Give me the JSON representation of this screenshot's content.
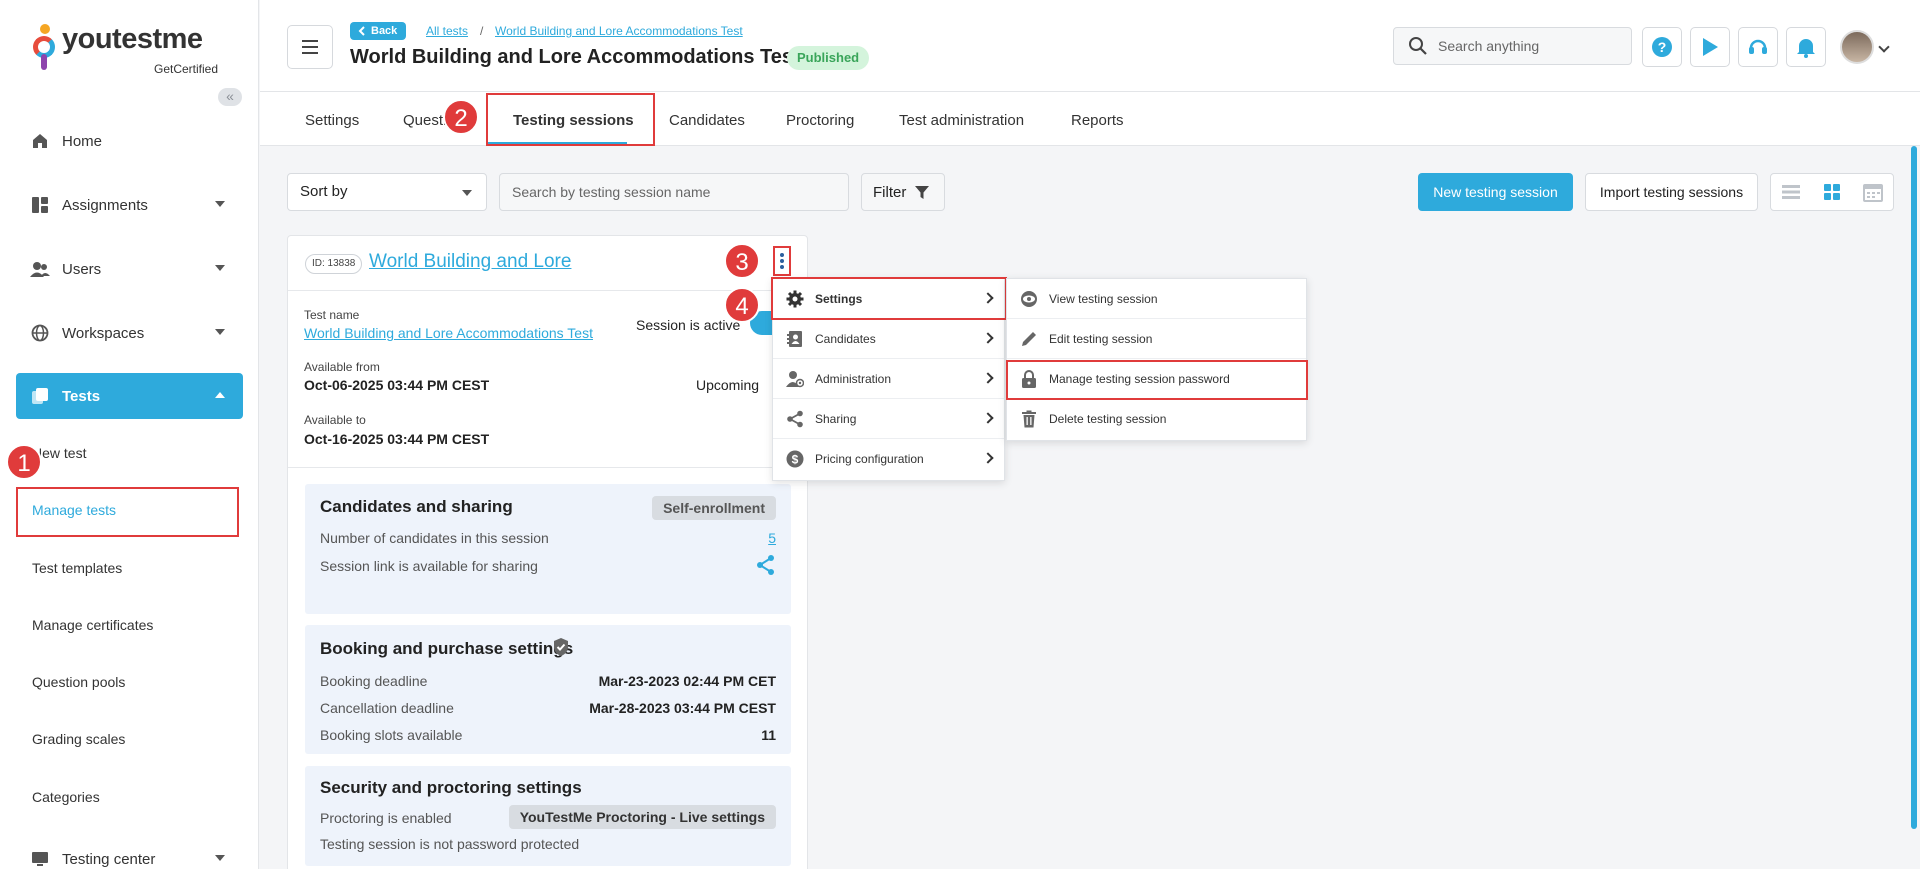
{
  "sidebar": {
    "logo_text": "youtestme",
    "logo_sub": "GetCertified",
    "collapse": "«",
    "items": [
      {
        "label": "Home"
      },
      {
        "label": "Assignments"
      },
      {
        "label": "Users"
      },
      {
        "label": "Workspaces"
      },
      {
        "label": "Tests"
      }
    ],
    "sub_items": [
      {
        "label": "New test"
      },
      {
        "label": "Manage tests"
      },
      {
        "label": "Test templates"
      },
      {
        "label": "Manage certificates"
      },
      {
        "label": "Question pools"
      },
      {
        "label": "Grading scales"
      },
      {
        "label": "Categories"
      }
    ],
    "testing_center": "Testing center"
  },
  "header": {
    "back": "Back",
    "crumb_all": "All tests",
    "crumb_sep": "/",
    "crumb_test": "World Building and Lore Accommodations Test",
    "title": "World Building and Lore Accommodations Test",
    "status": "Published",
    "search_placeholder": "Search anything"
  },
  "tabs": [
    {
      "label": "Settings"
    },
    {
      "label": "Questi"
    },
    {
      "label": "Testing sessions"
    },
    {
      "label": "Candidates"
    },
    {
      "label": "Proctoring"
    },
    {
      "label": "Test administration"
    },
    {
      "label": "Reports"
    }
  ],
  "toolbar": {
    "sort_label": "Sort by",
    "search_placeholder": "Search by testing session name",
    "filter_label": "Filter",
    "new_session": "New testing session",
    "import_sessions": "Import testing sessions"
  },
  "card": {
    "id": "ID: 13838",
    "title": "World Building and Lore",
    "test_name_label": "Test name",
    "test_name": "World Building and Lore Accommodations Test",
    "session_state": "Session is active",
    "available_from_label": "Available from",
    "available_from": "Oct-06-2025 03:44 PM CEST",
    "upcoming": "Upcoming",
    "available_to_label": "Available to",
    "available_to": "Oct-16-2025 03:44 PM CEST",
    "candidates_panel": {
      "title": "Candidates and sharing",
      "chip": "Self-enrollment",
      "num_label": "Number of candidates in this session",
      "num_value": "5",
      "link_label": "Session link is available for sharing"
    },
    "booking_panel": {
      "title": "Booking and purchase settings",
      "rows": [
        {
          "label": "Booking deadline",
          "value": "Mar-23-2023 02:44 PM CET"
        },
        {
          "label": "Cancellation deadline",
          "value": "Mar-28-2023 03:44 PM CEST"
        },
        {
          "label": "Booking slots available",
          "value": "11"
        }
      ]
    },
    "security_panel": {
      "title": "Security and proctoring settings",
      "proctoring_label": "Proctoring is enabled",
      "proctoring_chip": "YouTestMe Proctoring - Live settings",
      "password_label": "Testing session is not password protected"
    }
  },
  "menu": {
    "items": [
      {
        "label": "Settings"
      },
      {
        "label": "Candidates"
      },
      {
        "label": "Administration"
      },
      {
        "label": "Sharing"
      },
      {
        "label": "Pricing configuration"
      }
    ],
    "submenu": [
      {
        "label": "View testing session"
      },
      {
        "label": "Edit testing session"
      },
      {
        "label": "Manage testing session password"
      },
      {
        "label": "Delete testing session"
      }
    ]
  },
  "steps": [
    "1",
    "2",
    "3",
    "4"
  ],
  "colors": {
    "accent": "#2eaadc",
    "highlight": "#e03b3b",
    "published_bg": "#d4f4dc"
  }
}
